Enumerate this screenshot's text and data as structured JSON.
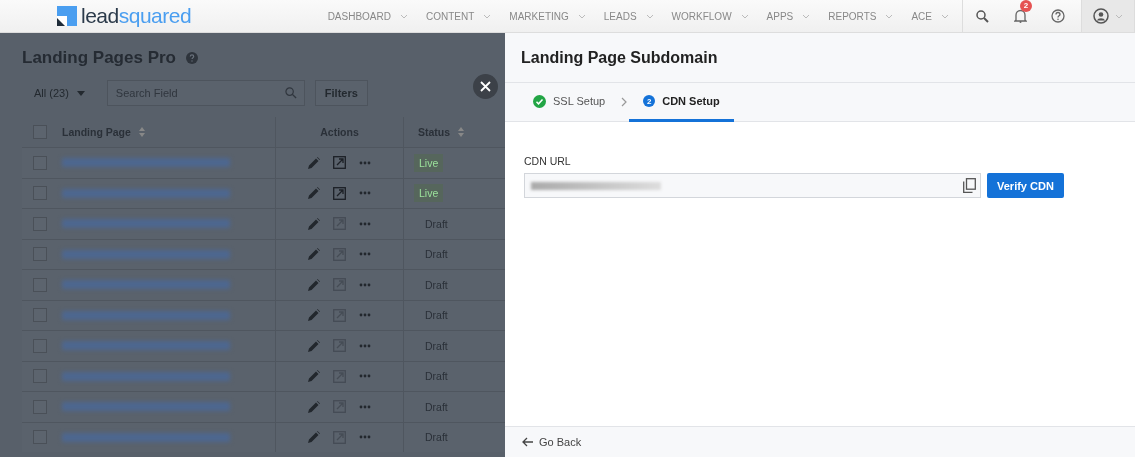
{
  "header": {
    "logo": {
      "part_1": "lead",
      "part_2": "squared"
    },
    "nav": [
      {
        "label": "DASHBOARD"
      },
      {
        "label": "CONTENT"
      },
      {
        "label": "MARKETING"
      },
      {
        "label": "LEADS"
      },
      {
        "label": "WORKFLOW"
      },
      {
        "label": "APPS"
      },
      {
        "label": "REPORTS"
      },
      {
        "label": "ACE"
      }
    ],
    "notification_count": "2"
  },
  "page": {
    "title": "Landing Pages Pro",
    "view_filter": "All (23)",
    "search": {
      "placeholder": "Search Field"
    },
    "filters_button": "Filters",
    "table": {
      "all_checked": false,
      "columns": [
        "Landing Page",
        "Actions",
        "Status"
      ],
      "rows": [
        {
          "checked": false,
          "status": "Live",
          "kind": "live"
        },
        {
          "checked": false,
          "status": "Live",
          "kind": "live"
        },
        {
          "checked": false,
          "status": "Draft",
          "kind": "draft"
        },
        {
          "checked": false,
          "status": "Draft",
          "kind": "draft"
        },
        {
          "checked": false,
          "status": "Draft",
          "kind": "draft"
        },
        {
          "checked": false,
          "status": "Draft",
          "kind": "draft"
        },
        {
          "checked": false,
          "status": "Draft",
          "kind": "draft"
        },
        {
          "checked": false,
          "status": "Draft",
          "kind": "draft"
        },
        {
          "checked": false,
          "status": "Draft",
          "kind": "draft"
        },
        {
          "checked": false,
          "status": "Draft",
          "kind": "draft"
        }
      ]
    }
  },
  "drawer": {
    "title": "Landing Page Subdomain",
    "steps": [
      {
        "label": "SSL Setup",
        "kind": "done",
        "selected": false
      },
      {
        "label": "CDN Setup",
        "number": "2",
        "kind": "numbered",
        "selected": true
      }
    ],
    "field": {
      "label": "CDN URL"
    },
    "verify_button": "Verify CDN",
    "back_link": "Go Back"
  }
}
